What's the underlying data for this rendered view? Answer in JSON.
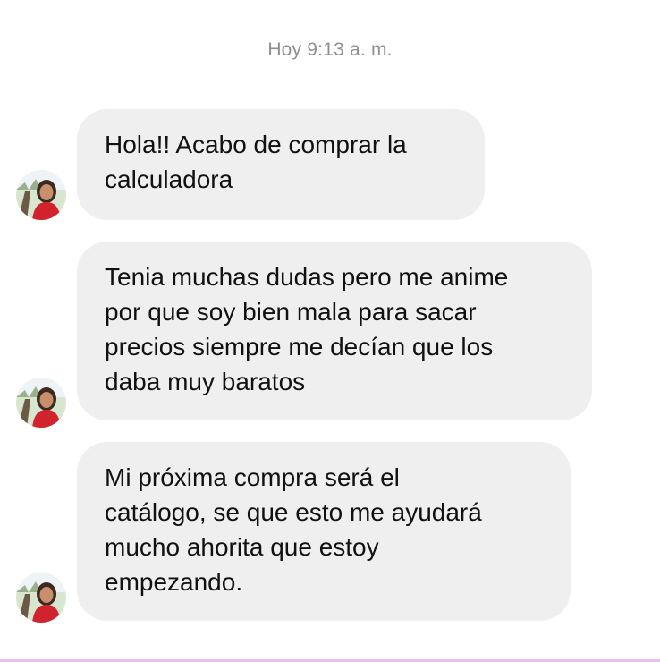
{
  "conversation": {
    "timestamp": "Hoy 9:13 a. m.",
    "messages": [
      {
        "lines": [
          "Hola!! Acabo de comprar la",
          "calculadora"
        ]
      },
      {
        "lines": [
          "Tenia muchas dudas pero me anime",
          "por que soy bien mala para sacar",
          "precios siempre me decían que los",
          "daba muy baratos"
        ]
      },
      {
        "lines": [
          "Mi próxima compra será el",
          "catálogo, se que esto me ayudará",
          "mucho ahorita que estoy",
          "empezando."
        ]
      }
    ]
  },
  "colors": {
    "bubble_bg": "#efeff0",
    "timestamp": "#8e8e93",
    "text": "#111111",
    "bottom_accent": "#e8bfe8"
  },
  "icons": {
    "avatar": "contact-avatar-photo"
  }
}
